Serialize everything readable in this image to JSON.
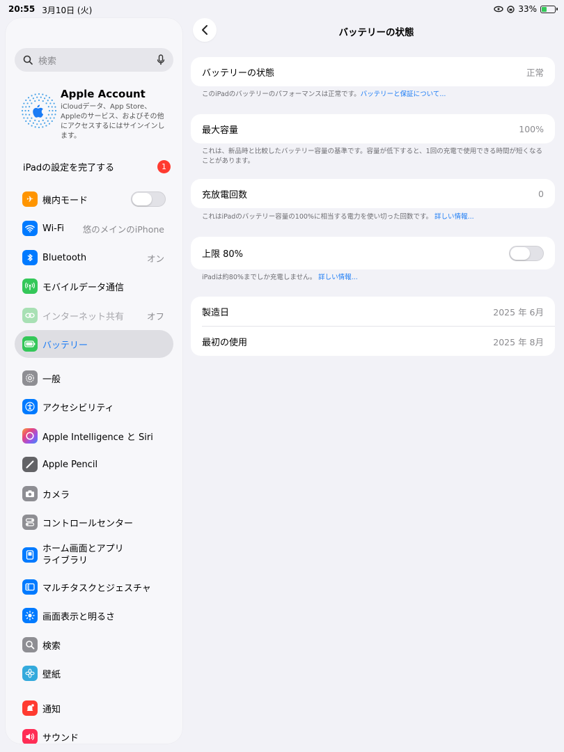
{
  "status_bar": {
    "time": "20:55",
    "date": "3月10日 (火)",
    "battery_percent_label": "33%",
    "battery_level": 0.33
  },
  "sidebar": {
    "search_placeholder": "検索",
    "account": {
      "title": "Apple Account",
      "subtitle": "iCloudデータ、App Store、Appleのサービス、およびその他にアクセスするにはサインインします。"
    },
    "setup": {
      "label": "iPadの設定を完了する",
      "badge": "1"
    },
    "items": [
      {
        "label": "機内モード",
        "icon": "airplane-icon",
        "color": "#ff9500"
      },
      {
        "label": "Wi-Fi",
        "value": "悠のメインのiPhone",
        "icon": "wifi-icon",
        "color": "#007aff"
      },
      {
        "label": "Bluetooth",
        "value": "オン",
        "icon": "bluetooth-icon",
        "color": "#007aff"
      },
      {
        "label": "モバイルデータ通信",
        "icon": "antenna-icon",
        "color": "#34c759"
      },
      {
        "label": "インターネット共有",
        "value": "オフ",
        "icon": "hotspot-icon",
        "color": "#a8e0b4"
      },
      {
        "label": "バッテリー",
        "icon": "battery-icon",
        "color": "#34c759"
      },
      {
        "label": "一般",
        "icon": "gear-icon",
        "color": "#8e8e93"
      },
      {
        "label": "アクセシビリティ",
        "icon": "accessibility-icon",
        "color": "#007aff"
      },
      {
        "label": "Apple Intelligence と Siri",
        "icon": "siri-icon",
        "color": "#c86dd7"
      },
      {
        "label": "Apple Pencil",
        "icon": "pencil-icon",
        "color": "#636366"
      },
      {
        "label": "カメラ",
        "icon": "camera-icon",
        "color": "#8e8e93"
      },
      {
        "label": "コントロールセンター",
        "icon": "control-center-icon",
        "color": "#8e8e93"
      },
      {
        "label_line1": "ホーム画面とアプリ",
        "label_line2": "ライブラリ",
        "icon": "home-screen-icon",
        "color": "#007aff"
      },
      {
        "label": "マルチタスクとジェスチャ",
        "icon": "multitask-icon",
        "color": "#007aff"
      },
      {
        "label": "画面表示と明るさ",
        "icon": "brightness-icon",
        "color": "#007aff"
      },
      {
        "label": "検索",
        "icon": "search-icon",
        "color": "#8e8e93"
      },
      {
        "label": "壁紙",
        "icon": "wallpaper-icon",
        "color": "#34aadc"
      },
      {
        "label": "通知",
        "icon": "notification-icon",
        "color": "#ff3b30"
      },
      {
        "label": "サウンド",
        "icon": "sound-icon",
        "color": "#ff2d55"
      }
    ]
  },
  "main": {
    "title": "バッテリーの状態",
    "health": {
      "label": "バッテリーの状態",
      "value": "正常",
      "note": "このiPadのバッテリーのパフォーマンスは正常です。",
      "note_link": "バッテリーと保証について..."
    },
    "capacity": {
      "label": "最大容量",
      "value": "100%",
      "note": "これは、新品時と比較したバッテリー容量の基準です。容量が低下すると、1回の充電で使用できる時間が短くなることがあります。"
    },
    "cycles": {
      "label": "充放電回数",
      "value": "0",
      "note": "これはiPadのバッテリー容量の100%に相当する電力を使い切った回数です。",
      "note_link": "詳しい情報..."
    },
    "limit": {
      "label": "上限 80%",
      "note": "iPadは約80%までしか充電しません。",
      "note_link": "詳しい情報..."
    },
    "manufacture": {
      "label": "製造日",
      "value": "2025 年 6月"
    },
    "first_use": {
      "label": "最初の使用",
      "value": "2025 年 8月"
    }
  }
}
